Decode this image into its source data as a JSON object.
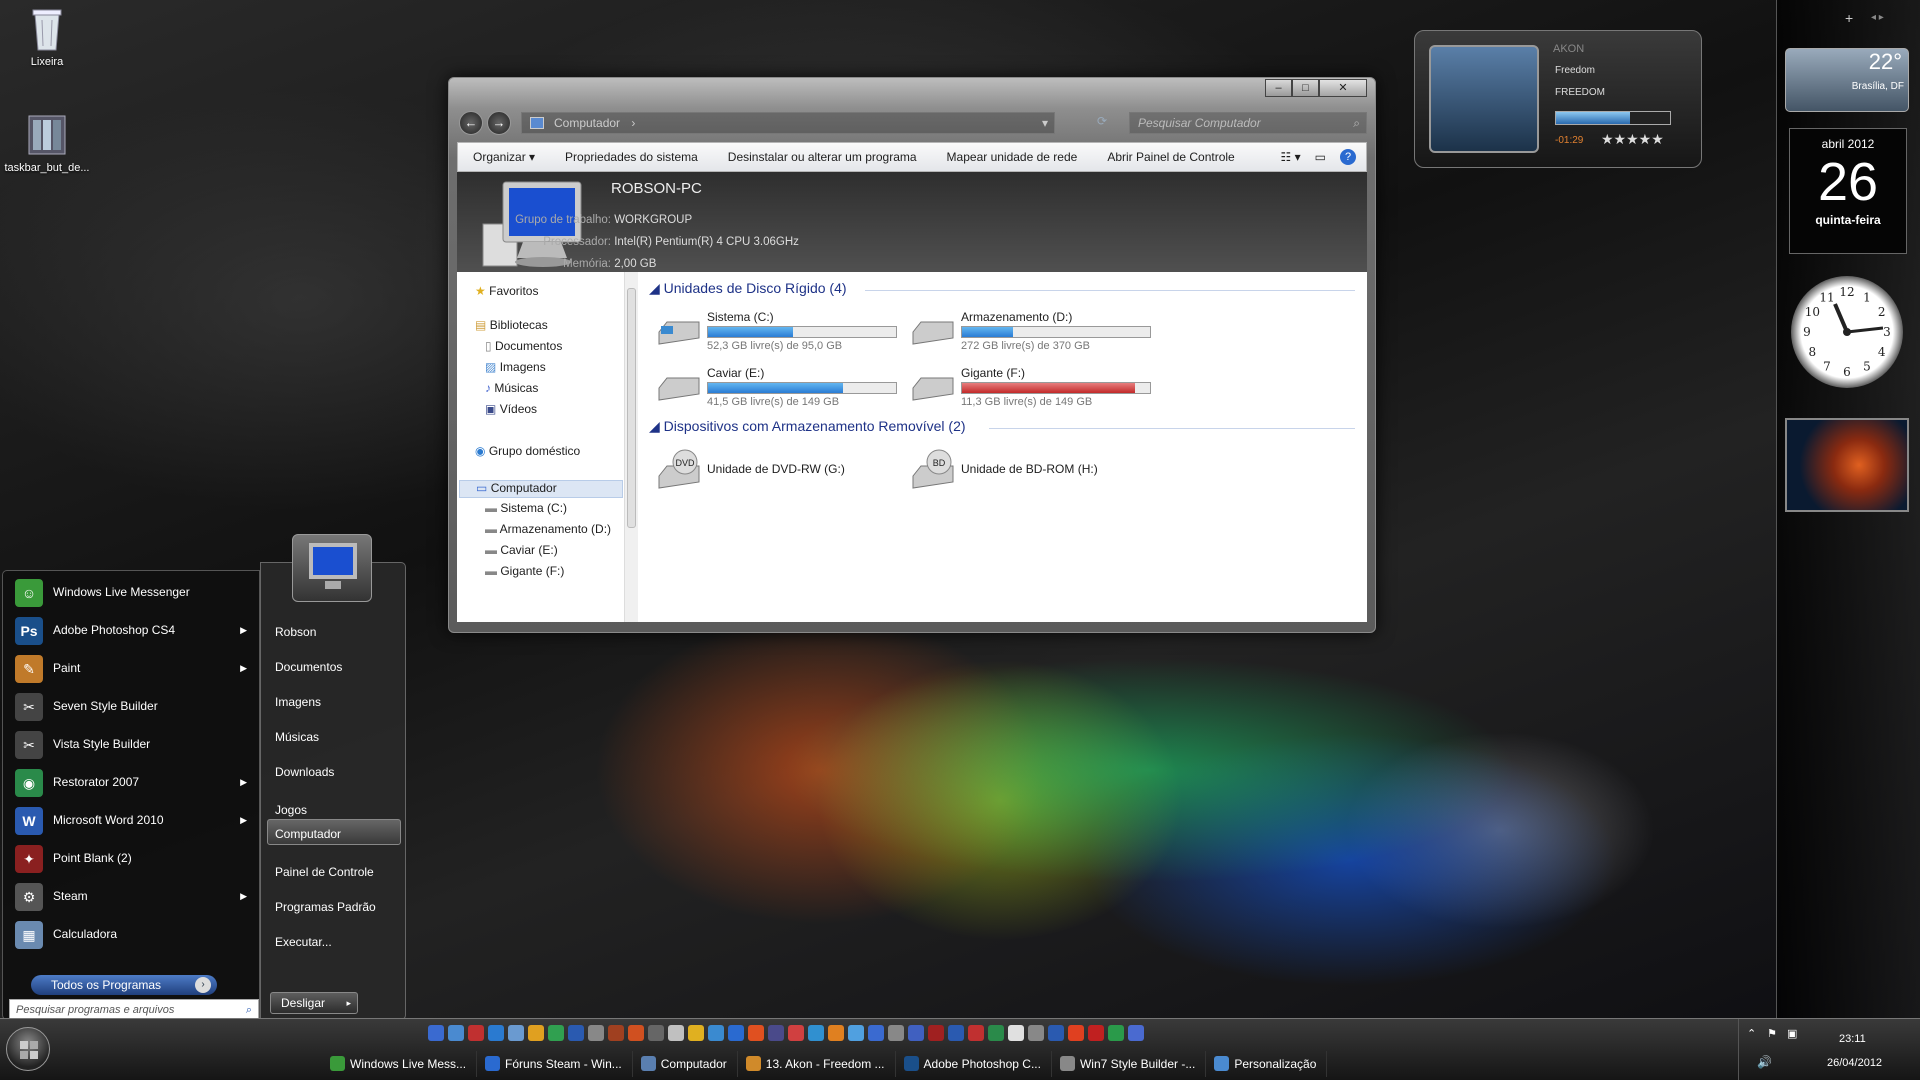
{
  "desktop": {
    "icons": [
      {
        "label": "Lixeira"
      },
      {
        "label": "taskbar_but_de..."
      }
    ]
  },
  "explorer": {
    "address": "Computador",
    "search_placeholder": "Pesquisar Computador",
    "toolbar": [
      "Organizar",
      "Propriedades do sistema",
      "Desinstalar ou alterar um programa",
      "Mapear unidade de rede",
      "Abrir Painel de Controle"
    ],
    "details": {
      "pc_name": "ROBSON-PC",
      "workgroup_label": "Grupo de trabalho:",
      "workgroup": "WORKGROUP",
      "cpu_label": "Processador:",
      "cpu": "Intel(R) Pentium(R) 4 CPU 3.06GHz",
      "mem_label": "Memória:",
      "mem": "2,00 GB"
    },
    "nav": {
      "favorites": "Favoritos",
      "libraries": "Bibliotecas",
      "lib_items": [
        "Documentos",
        "Imagens",
        "Músicas",
        "Vídeos"
      ],
      "homegroup": "Grupo doméstico",
      "computer": "Computador",
      "drives": [
        "Sistema (C:)",
        "Armazenamento (D:)",
        "Caviar (E:)",
        "Gigante (F:)"
      ]
    },
    "hdd_group": "Unidades de Disco Rígido (4)",
    "hdd": [
      {
        "name": "Sistema (C:)",
        "free": "52,3 GB livre(s) de 95,0 GB",
        "used_fraction": 0.45,
        "color": "#2a7cd4"
      },
      {
        "name": "Armazenamento (D:)",
        "free": "272 GB livre(s) de 370 GB",
        "used_fraction": 0.27,
        "color": "#2a7cd4"
      },
      {
        "name": "Caviar (E:)",
        "free": "41,5 GB livre(s) de 149 GB",
        "used_fraction": 0.72,
        "color": "#2a7cd4"
      },
      {
        "name": "Gigante (F:)",
        "free": "11,3 GB livre(s) de 149 GB",
        "used_fraction": 0.92,
        "color": "#c22a2a"
      }
    ],
    "removable_group": "Dispositivos com Armazenamento Removível (2)",
    "removable": [
      {
        "name": "Unidade de DVD-RW (G:)",
        "badge": "DVD"
      },
      {
        "name": "Unidade de BD-ROM (H:)",
        "badge": "BD"
      }
    ]
  },
  "startmenu": {
    "programs": [
      {
        "label": "Windows Live Messenger",
        "icon": "messenger-icon",
        "color": "#3a9a3a",
        "glyph": "☺",
        "arrow": false
      },
      {
        "label": "Adobe Photoshop CS4",
        "icon": "photoshop-icon",
        "color": "#1a4f8a",
        "glyph": "Ps",
        "arrow": true
      },
      {
        "label": "Paint",
        "icon": "paint-icon",
        "color": "#c07a2a",
        "glyph": "✎",
        "arrow": true
      },
      {
        "label": "Seven Style Builder",
        "icon": "style-builder-icon",
        "color": "#444",
        "glyph": "✂",
        "arrow": false
      },
      {
        "label": "Vista Style Builder",
        "icon": "vista-builder-icon",
        "color": "#444",
        "glyph": "✂",
        "arrow": false
      },
      {
        "label": "Restorator 2007",
        "icon": "restorator-icon",
        "color": "#2a8a4a",
        "glyph": "◉",
        "arrow": true
      },
      {
        "label": "Microsoft Word 2010",
        "icon": "word-icon",
        "color": "#2a5ab0",
        "glyph": "W",
        "arrow": true
      },
      {
        "label": "Point Blank (2)",
        "icon": "pointblank-icon",
        "color": "#8a2020",
        "glyph": "✦",
        "arrow": false
      },
      {
        "label": "Steam",
        "icon": "steam-icon",
        "color": "#555",
        "glyph": "⚙",
        "arrow": true
      },
      {
        "label": "Calculadora",
        "icon": "calculator-icon",
        "color": "#6a8ab0",
        "glyph": "▦",
        "arrow": false
      }
    ],
    "all_programs": "Todos os Programas",
    "search_placeholder": "Pesquisar programas e arquivos",
    "right": [
      "Robson",
      "Documentos",
      "Imagens",
      "Músicas",
      "Downloads",
      "Jogos",
      "Computador",
      "Painel de Controle",
      "Programas Padrão",
      "Executar..."
    ],
    "shutdown": "Desligar"
  },
  "taskbar": {
    "tasks": [
      {
        "label": "Windows Live Mess...",
        "color": "#3a9a3a"
      },
      {
        "label": "Fóruns Steam - Win...",
        "color": "#2a6ad0"
      },
      {
        "label": "Computador",
        "color": "#5a7fb0"
      },
      {
        "label": "13. Akon - Freedom ...",
        "color": "#d08a2a"
      },
      {
        "label": "Adobe Photoshop C...",
        "color": "#1a4f8a"
      },
      {
        "label": "Win7 Style Builder -...",
        "color": "#888"
      },
      {
        "label": "Personalização",
        "color": "#4a8ad0"
      }
    ],
    "time": "23:11",
    "date": "26/04/2012"
  },
  "gadgets": {
    "weather_temp": "22°",
    "weather_city": "Brasília, DF",
    "calendar_month": "abril 2012",
    "calendar_day": "26",
    "calendar_weekday": "quinta-feira",
    "clock_numbers": [
      "12",
      "1",
      "2",
      "3",
      "4",
      "5",
      "6",
      "7",
      "8",
      "9",
      "10",
      "11"
    ]
  },
  "media": {
    "artist": "AKON",
    "album": "Freedom",
    "track": "FREEDOM",
    "elapsed": "-01:29",
    "rating_stars": "★★★★★",
    "progress_fraction": 0.65
  }
}
